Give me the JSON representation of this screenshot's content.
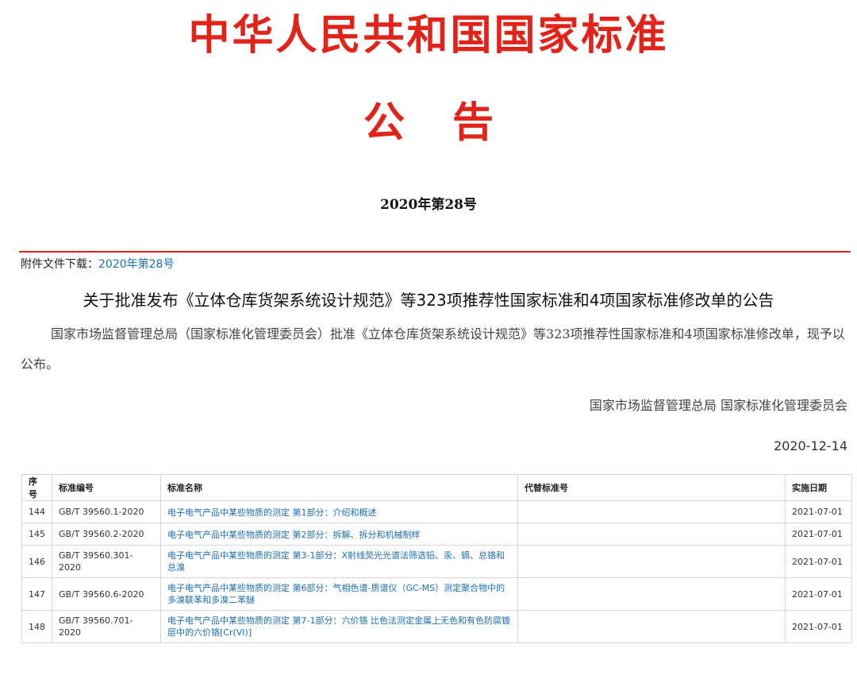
{
  "header": {
    "title": "中华人民共和国国家标准",
    "subtitle": "公告",
    "issue_number": "2020年第28号"
  },
  "colors": {
    "accent_red": "#e2231a",
    "link_blue": "#1b6fb6"
  },
  "attachment": {
    "label": "附件文件下载：",
    "link_text": "2020年第28号"
  },
  "notice": {
    "heading": "关于批准发布《立体仓库货架系统设计规范》等323项推荐性国家标准和4项国家标准修改单的公告",
    "body": "国家市场监督管理总局（国家标准化管理委员会）批准《立体仓库货架系统设计规范》等323项推荐性国家标准和4项国家标准修改单，现予以公布。",
    "issuer": "国家市场监督管理总局 国家标准化管理委员会",
    "date": "2020-12-14"
  },
  "table": {
    "headers": [
      "序号",
      "标准编号",
      "标准名称",
      "代替标准号",
      "实施日期"
    ],
    "rows": [
      [
        "144",
        "GB/T 39560.1-2020",
        "电子电气产品中某些物质的测定 第1部分：介绍和概述",
        "",
        "2021-07-01"
      ],
      [
        "145",
        "GB/T 39560.2-2020",
        "电子电气产品中某些物质的测定 第2部分：拆解、拆分和机械制样",
        "",
        "2021-07-01"
      ],
      [
        "146",
        "GB/T 39560.301-2020",
        "电子电气产品中某些物质的测定 第3-1部分：X射线荧光光谱法筛选铅、汞、镉、总铬和总溴",
        "",
        "2021-07-01"
      ],
      [
        "147",
        "GB/T 39560.6-2020",
        "电子电气产品中某些物质的测定 第6部分：气相色谱-质谱仪（GC-MS）测定聚合物中的多溴联苯和多溴二苯醚",
        "",
        "2021-07-01"
      ],
      [
        "148",
        "GB/T 39560.701-2020",
        "电子电气产品中某些物质的测定 第7-1部分：六价铬 比色法测定金属上无色和有色防腐镀层中的六价铬[Cr(VI)]",
        "",
        "2021-07-01"
      ]
    ]
  }
}
